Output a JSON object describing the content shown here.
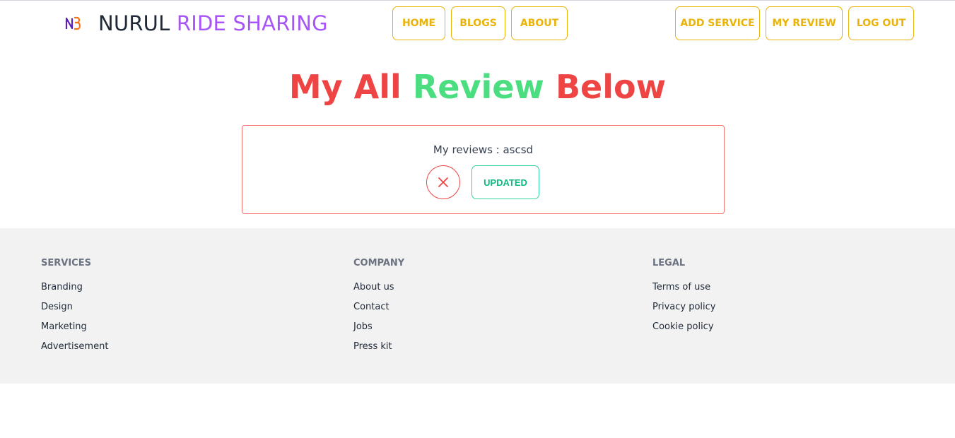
{
  "brand": {
    "name": "NURUL",
    "accent": "RIDE SHARING"
  },
  "nav": {
    "home": "HOME",
    "blogs": "BLOGS",
    "about": "ABOUT",
    "add_service": "ADD SERVICE",
    "my_review": "MY REVIEW",
    "log_out": "LOG OUT"
  },
  "page": {
    "title_part1": "My All",
    "title_part2": "Review",
    "title_part3": "Below"
  },
  "review": {
    "text": "My reviews : ascsd",
    "update_label": "UPDATED"
  },
  "footer": {
    "services": {
      "title": "SERVICES",
      "links": [
        "Branding",
        "Design",
        "Marketing",
        "Advertisement"
      ]
    },
    "company": {
      "title": "COMPANY",
      "links": [
        "About us",
        "Contact",
        "Jobs",
        "Press kit"
      ]
    },
    "legal": {
      "title": "LEGAL",
      "links": [
        "Terms of use",
        "Privacy policy",
        "Cookie policy"
      ]
    }
  },
  "colors": {
    "nav_accent": "#eab308",
    "brand_accent": "#a855f7",
    "title_red": "#ef4444",
    "title_green": "#4ade80",
    "delete_red": "#ef4444",
    "update_green": "#10b981",
    "footer_bg": "#f2f2f2"
  },
  "icons": {
    "logo": "nb-logo-icon",
    "delete": "close-icon"
  }
}
